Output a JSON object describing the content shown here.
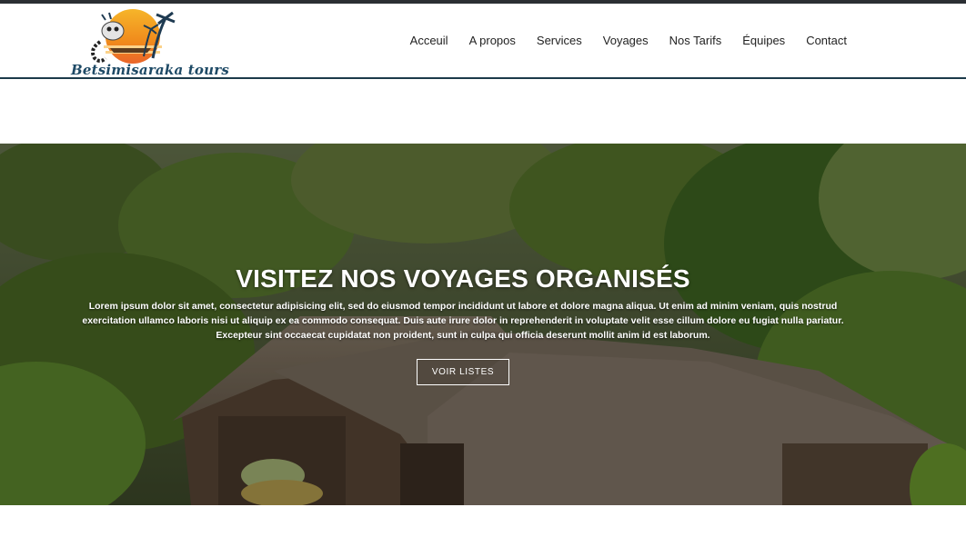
{
  "brand": {
    "name": "Betsimisaraka tours"
  },
  "nav": {
    "items": [
      {
        "label": "Acceuil"
      },
      {
        "label": "A propos"
      },
      {
        "label": "Services"
      },
      {
        "label": "Voyages"
      },
      {
        "label": "Nos Tarifs"
      },
      {
        "label": "Équipes"
      },
      {
        "label": "Contact"
      }
    ]
  },
  "hero": {
    "title": "VISITEZ NOS VOYAGES ORGANISÉS",
    "text": "Lorem ipsum dolor sit amet, consectetur adipisicing elit, sed do eiusmod tempor incididunt ut labore et dolore magna aliqua. Ut enim ad minim veniam, quis nostrud exercitation ullamco laboris nisi ut aliquip ex ea commodo consequat. Duis aute irure dolor in reprehenderit in voluptate velit esse cillum dolore eu fugiat nulla pariatur. Excepteur sint occaecat cupidatat non proident, sunt in culpa qui officia deserunt mollit anim id est laborum.",
    "button_label": "VOIR LISTES"
  },
  "colors": {
    "header_border": "#1c3a4a",
    "brand_text": "#1e4a66",
    "logo_sun": "#f39a1f"
  }
}
